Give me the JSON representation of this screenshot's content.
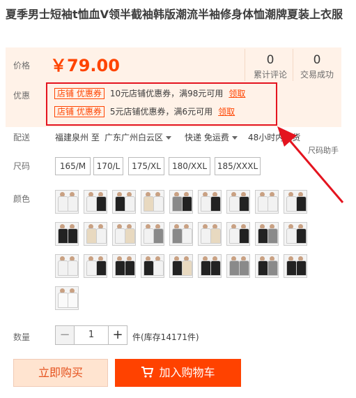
{
  "title": "夏季男士短袖t恤血V领半截袖韩版潮流半袖修身体恤潮牌夏装上衣服",
  "price": {
    "label": "价格",
    "value": "￥79.00"
  },
  "stats": [
    {
      "count": "0",
      "label": "累计评论"
    },
    {
      "count": "0",
      "label": "交易成功"
    }
  ],
  "promo": {
    "label": "优惠",
    "coupons": [
      {
        "tag": "店铺 优惠券",
        "text": "10元店铺优惠券，满98元可用",
        "link": "领取"
      },
      {
        "tag": "店铺 优惠券",
        "text": "5元店铺优惠券，满6元可用",
        "link": "领取"
      }
    ]
  },
  "delivery": {
    "label": "配送",
    "from": "福建泉州 至",
    "to": "广东广州白云区",
    "shipping": "快递 免运费",
    "time": "48小时内发货",
    "size_helper": "尺码助手"
  },
  "size": {
    "label": "尺码",
    "options": [
      "165/M",
      "170/L",
      "175/XL",
      "180/XXL",
      "185/XXXL"
    ]
  },
  "color": {
    "label": "颜色",
    "swatches": [
      [
        "white",
        "white"
      ],
      [
        "white",
        "black"
      ],
      [
        "black",
        "white"
      ],
      [
        "beige",
        "white"
      ],
      [
        "gray",
        "black"
      ],
      [
        "white",
        "black"
      ],
      [
        "white",
        "black"
      ],
      [
        "white",
        "white"
      ],
      [
        "white",
        "black"
      ],
      [
        "black",
        "black"
      ],
      [
        "beige",
        "white"
      ],
      [
        "white",
        "beige"
      ],
      [
        "white",
        "gray"
      ],
      [
        "gray",
        "white"
      ],
      [
        "white",
        "beige"
      ],
      [
        "white",
        "black"
      ],
      [
        "black",
        "gray"
      ],
      [
        "white",
        "black"
      ],
      [
        "white",
        "white"
      ],
      [
        "white",
        "black"
      ],
      [
        "black",
        "black"
      ],
      [
        "black",
        "white"
      ],
      [
        "black",
        "beige"
      ],
      [
        "black",
        "black"
      ],
      [
        "gray",
        "gray"
      ],
      [
        "black",
        "gray"
      ],
      [
        "black",
        "black"
      ],
      [
        "light",
        "light"
      ]
    ]
  },
  "quantity": {
    "label": "数量",
    "minus": "−",
    "value": "1",
    "plus": "+",
    "stock_text": "件(库存14171件)"
  },
  "buttons": {
    "buy_now": "立即购买",
    "add_to_cart": "加入购物车",
    "cart_icon": "cart-icon"
  },
  "colors": {
    "accent": "#ff4400",
    "annotation_red": "#e4141f",
    "price_bg": "#fff2e8"
  }
}
